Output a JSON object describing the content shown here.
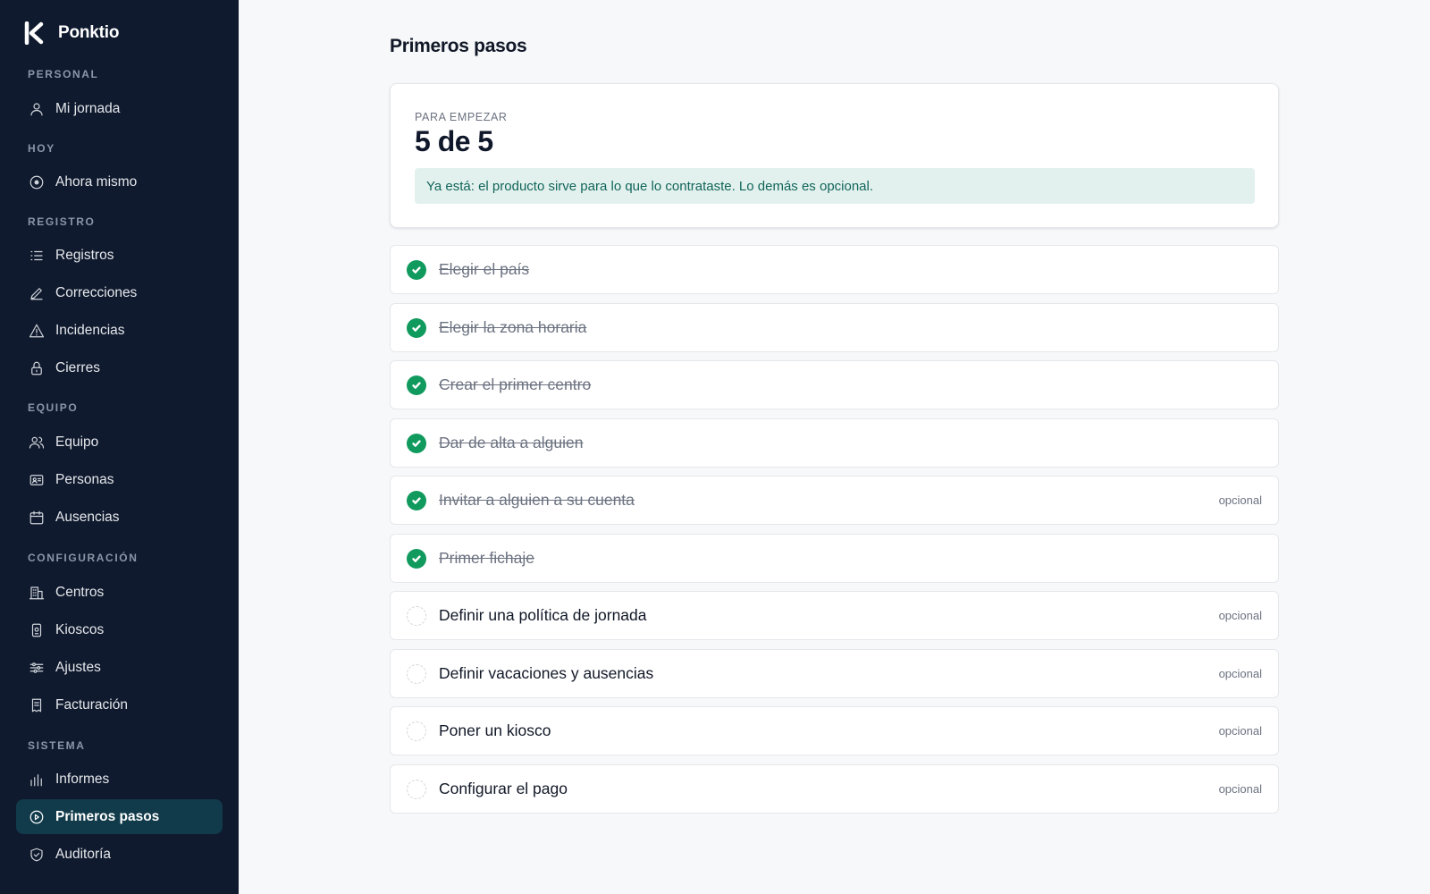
{
  "brand": {
    "name": "Ponktio"
  },
  "sidebar": {
    "sections": [
      {
        "title": "PERSONAL",
        "items": [
          {
            "label": "Mi jornada",
            "icon": "user-icon"
          }
        ]
      },
      {
        "title": "HOY",
        "items": [
          {
            "label": "Ahora mismo",
            "icon": "target-icon"
          }
        ]
      },
      {
        "title": "REGISTRO",
        "items": [
          {
            "label": "Registros",
            "icon": "list-icon"
          },
          {
            "label": "Correcciones",
            "icon": "pencil-icon"
          },
          {
            "label": "Incidencias",
            "icon": "warning-icon"
          },
          {
            "label": "Cierres",
            "icon": "lock-icon"
          }
        ]
      },
      {
        "title": "EQUIPO",
        "items": [
          {
            "label": "Equipo",
            "icon": "users-icon"
          },
          {
            "label": "Personas",
            "icon": "id-card-icon"
          },
          {
            "label": "Ausencias",
            "icon": "calendar-icon"
          }
        ]
      },
      {
        "title": "CONFIGURACIÓN",
        "items": [
          {
            "label": "Centros",
            "icon": "building-icon"
          },
          {
            "label": "Kioscos",
            "icon": "kiosk-icon"
          },
          {
            "label": "Ajustes",
            "icon": "sliders-icon"
          },
          {
            "label": "Facturación",
            "icon": "receipt-icon"
          }
        ]
      },
      {
        "title": "SISTEMA",
        "items": [
          {
            "label": "Informes",
            "icon": "bar-chart-icon"
          },
          {
            "label": "Primeros pasos",
            "icon": "play-circle-icon",
            "active": true
          },
          {
            "label": "Auditoría",
            "icon": "shield-icon"
          }
        ]
      }
    ]
  },
  "main": {
    "title": "Primeros pasos",
    "summary": {
      "eyebrow": "PARA EMPEZAR",
      "count": "5 de 5",
      "banner": "Ya está: el producto sirve para lo que lo contrataste. Lo demás es opcional."
    },
    "steps": [
      {
        "label": "Elegir el país",
        "done": true,
        "optional": ""
      },
      {
        "label": "Elegir la zona horaria",
        "done": true,
        "optional": ""
      },
      {
        "label": "Crear el primer centro",
        "done": true,
        "optional": ""
      },
      {
        "label": "Dar de alta a alguien",
        "done": true,
        "optional": ""
      },
      {
        "label": "Invitar a alguien a su cuenta",
        "done": true,
        "optional": "opcional"
      },
      {
        "label": "Primer fichaje",
        "done": true,
        "optional": ""
      },
      {
        "label": "Definir una política de jornada",
        "done": false,
        "optional": "opcional"
      },
      {
        "label": "Definir vacaciones y ausencias",
        "done": false,
        "optional": "opcional"
      },
      {
        "label": "Poner un kiosco",
        "done": false,
        "optional": "opcional"
      },
      {
        "label": "Configurar el pago",
        "done": false,
        "optional": "opcional"
      }
    ]
  },
  "colors": {
    "sidebar_bg": "#0f1a2e",
    "active_item_bg": "#113a4a",
    "check_green": "#119a5e",
    "banner_bg": "#e3f1ee",
    "banner_text": "#11655a"
  }
}
